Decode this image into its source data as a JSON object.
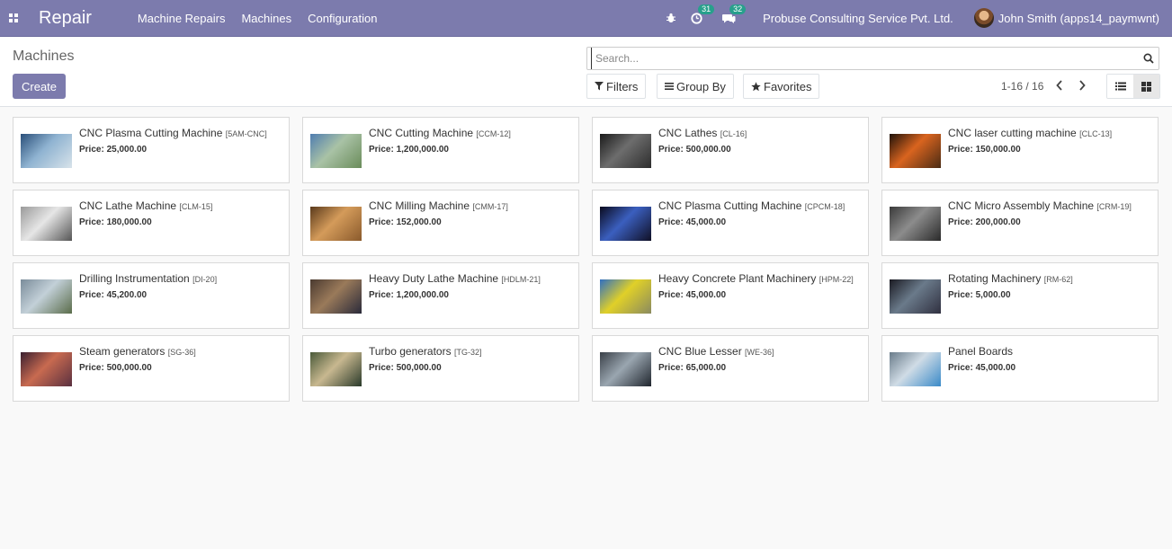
{
  "navbar": {
    "brand": "Repair",
    "menu": [
      "Machine Repairs",
      "Machines",
      "Configuration"
    ],
    "activity_count": "31",
    "messages_count": "32",
    "company": "Probuse Consulting Service Pvt. Ltd.",
    "user": "John Smith (apps14_paymwnt)"
  },
  "control_panel": {
    "title": "Machines",
    "create_label": "Create",
    "search_placeholder": "Search...",
    "filters_label": "Filters",
    "group_by_label": "Group By",
    "favorites_label": "Favorites",
    "pager": "1-16 / 16"
  },
  "price_label": "Price:",
  "machines": [
    {
      "name": "CNC Plasma Cutting Machine",
      "ref": "[5AM-CNC]",
      "price": "25,000.00",
      "thumb": [
        "#2a4f7a",
        "#8fb3d1",
        "#d8e3ea"
      ]
    },
    {
      "name": "CNC Cutting Machine",
      "ref": "[CCM-12]",
      "price": "1,200,000.00",
      "thumb": [
        "#4f7db0",
        "#a9c2a6",
        "#6a8c5a"
      ]
    },
    {
      "name": "CNC Lathes",
      "ref": "[CL-16]",
      "price": "500,000.00",
      "thumb": [
        "#1a1a1a",
        "#6d6d6d",
        "#2d2d2d"
      ]
    },
    {
      "name": "CNC laser cutting machine",
      "ref": "[CLC-13]",
      "price": "150,000.00",
      "thumb": [
        "#1e120a",
        "#d9641f",
        "#4a2b14"
      ]
    },
    {
      "name": "CNC Lathe Machine",
      "ref": "[CLM-15]",
      "price": "180,000.00",
      "thumb": [
        "#9a9a9a",
        "#e6e6e6",
        "#555555"
      ]
    },
    {
      "name": "CNC Milling Machine",
      "ref": "[CMM-17]",
      "price": "152,000.00",
      "thumb": [
        "#5a3a1c",
        "#d49b5a",
        "#8a5a2c"
      ]
    },
    {
      "name": "CNC Plasma Cutting Machine",
      "ref": "[CPCM-18]",
      "price": "45,000.00",
      "thumb": [
        "#0a0a1e",
        "#3b5fbf",
        "#101025"
      ]
    },
    {
      "name": "CNC Micro Assembly Machine",
      "ref": "[CRM-19]",
      "price": "200,000.00",
      "thumb": [
        "#3a3a3a",
        "#8c8c8c",
        "#2a2a2a"
      ]
    },
    {
      "name": "Drilling Instrumentation",
      "ref": "[DI-20]",
      "price": "45,200.00",
      "thumb": [
        "#7a8c9a",
        "#c3d0d8",
        "#5a6c4a"
      ]
    },
    {
      "name": "Heavy Duty Lathe Machine",
      "ref": "[HDLM-21]",
      "price": "1,200,000.00",
      "thumb": [
        "#4a3a30",
        "#9a7a5a",
        "#2a2a3a"
      ]
    },
    {
      "name": "Heavy Concrete Plant Machinery",
      "ref": "[HPM-22]",
      "price": "45,000.00",
      "thumb": [
        "#2f6fc2",
        "#e0d028",
        "#8a8a60"
      ]
    },
    {
      "name": "Rotating Machinery",
      "ref": "[RM-62]",
      "price": "5,000.00",
      "thumb": [
        "#1a1a22",
        "#6a7a8a",
        "#303040"
      ]
    },
    {
      "name": "Steam generators",
      "ref": "[SG-36]",
      "price": "500,000.00",
      "thumb": [
        "#3a2030",
        "#c86a50",
        "#5a3040"
      ]
    },
    {
      "name": "Turbo generators",
      "ref": "[TG-32]",
      "price": "500,000.00",
      "thumb": [
        "#4a5a3a",
        "#c8b890",
        "#2a3a2a"
      ]
    },
    {
      "name": "CNC Blue Lesser",
      "ref": "[WE-36]",
      "price": "65,000.00",
      "thumb": [
        "#3a4048",
        "#9aa6b0",
        "#20262e"
      ]
    },
    {
      "name": "Panel Boards",
      "ref": "",
      "price": "45,000.00",
      "thumb": [
        "#6a7c8a",
        "#d0dce6",
        "#3a8ac8"
      ]
    }
  ],
  "colors": {
    "navbar": "#7c7bad",
    "primary_button": "#7c7bad",
    "badge": "#28a08c"
  }
}
